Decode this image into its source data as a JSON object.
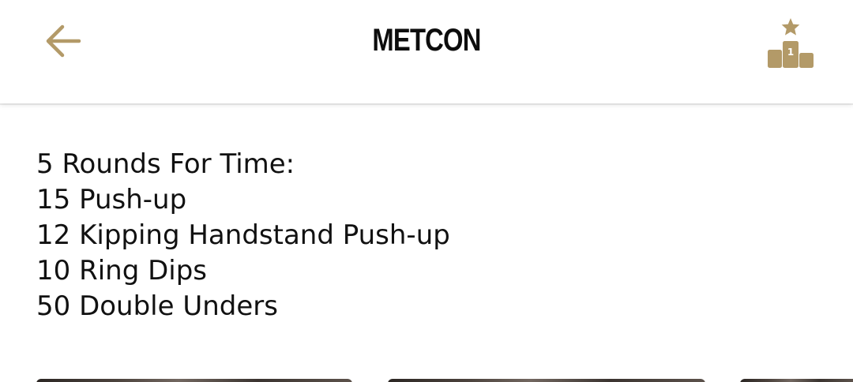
{
  "header": {
    "title": "METCON",
    "back_icon": "arrow-left-icon",
    "leaderboard_icon": "podium-star-icon",
    "leaderboard_badge": "1",
    "accent_color": "#B39A68"
  },
  "workout": {
    "lines": [
      "5 Rounds For Time:",
      "15 Push-up",
      "12 Kipping Handstand Push-up",
      "10 Ring Dips",
      "50 Double Unders"
    ]
  },
  "media": {
    "thumbnails": [
      "video-thumbnail",
      "video-thumbnail",
      "video-thumbnail"
    ]
  }
}
